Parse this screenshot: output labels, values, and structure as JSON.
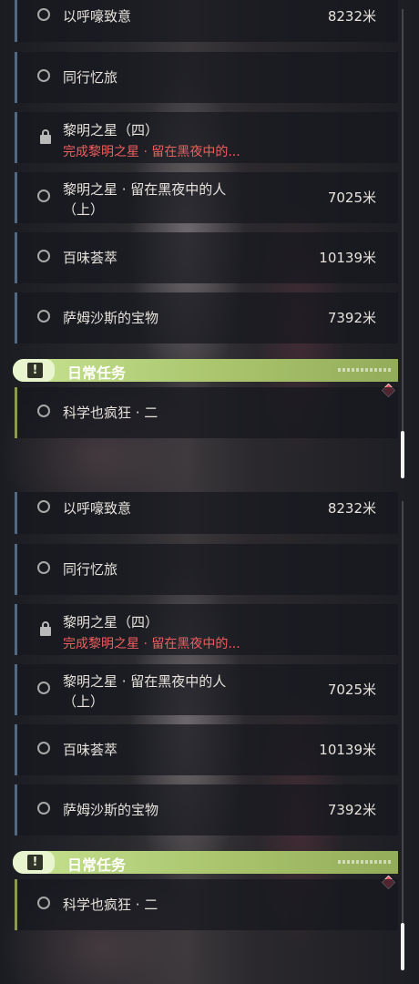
{
  "quests": [
    {
      "title": "以呼嚎致意",
      "distance": "8232米",
      "icon": "circle-icon"
    },
    {
      "title": "同行忆旅",
      "distance": "",
      "icon": "circle-icon"
    },
    {
      "title": "黎明之星（四）",
      "requirement": "完成黎明之星 · 留在黑夜中的...",
      "icon": "lock-icon"
    },
    {
      "title": "黎明之星 · 留在黑夜中的人（上）",
      "distance": "7025米",
      "icon": "circle-icon"
    },
    {
      "title": "百味荟萃",
      "distance": "10139米",
      "icon": "circle-icon"
    },
    {
      "title": "萨姆沙斯的宝物",
      "distance": "7392米",
      "icon": "circle-icon"
    }
  ],
  "daily": {
    "header": "日常任务",
    "header_icon": "exclamation-icon",
    "items": [
      {
        "title": "科学也疯狂 · 二",
        "icon": "circle-icon"
      }
    ]
  },
  "colors": {
    "accent_green": "#b8d67e",
    "warning_red": "#ef5e5e",
    "item_border": "#556a80"
  }
}
